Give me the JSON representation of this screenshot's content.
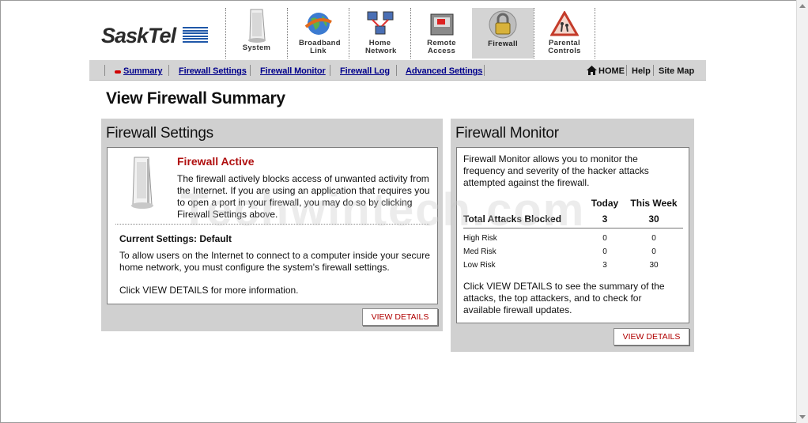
{
  "brand": {
    "name": "SaskTel",
    "accent": "#1f57a8"
  },
  "nav": [
    {
      "label": "System",
      "icon": "modem-icon"
    },
    {
      "label": "Broadband Link",
      "icon": "globe-icon"
    },
    {
      "label": "Home Network",
      "icon": "network-icon"
    },
    {
      "label": "Remote Access",
      "icon": "remote-access-icon"
    },
    {
      "label": "Firewall",
      "icon": "padlock-icon",
      "active": true
    },
    {
      "label": "Parental Controls",
      "icon": "warning-sign-icon"
    }
  ],
  "subnav": {
    "links": [
      "Summary",
      "Firewall Settings",
      "Firewall Monitor",
      "Firewall Log",
      "Advanced Settings"
    ],
    "home": "HOME",
    "help": "Help",
    "sitemap": "Site Map"
  },
  "page_title": "View Firewall Summary",
  "settings": {
    "title": "Firewall Settings",
    "status": "Firewall Active",
    "description": "The firewall actively blocks access of unwanted activity from the Internet. If you are using an application that requires you to open a port in your firewall, you may do so by clicking Firewall Settings above.",
    "current": "Current Settings: Default",
    "info": "To allow users on the Internet to connect to a computer inside your secure home network, you must configure the system's firewall settings.",
    "more": "Click VIEW DETAILS for more information.",
    "button": "VIEW DETAILS"
  },
  "monitor": {
    "title": "Firewall Monitor",
    "intro": "Firewall Monitor allows you to monitor the frequency and severity of the hacker attacks attempted against the firewall.",
    "col_today": "Today",
    "col_week": "This Week",
    "total_label": "Total Attacks Blocked",
    "total_today": "3",
    "total_week": "30",
    "rows": [
      {
        "label": "High Risk",
        "today": "0",
        "week": "0"
      },
      {
        "label": "Med Risk",
        "today": "0",
        "week": "0"
      },
      {
        "label": "Low Risk",
        "today": "3",
        "week": "30"
      }
    ],
    "footer": "Click VIEW DETAILS to see the summary of the attacks, the top attackers, and to check for available firewall updates.",
    "button": "VIEW DETAILS"
  },
  "watermark": "Techwintech.com"
}
